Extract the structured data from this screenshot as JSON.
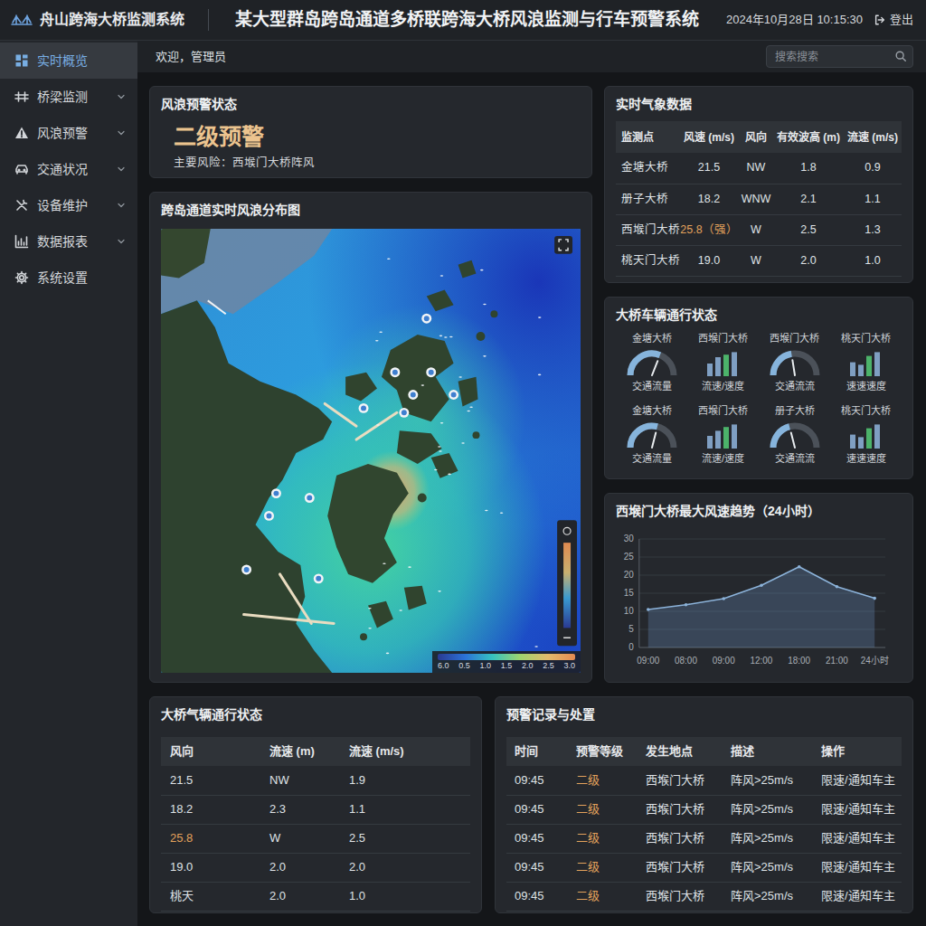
{
  "header": {
    "logo": "舟山跨海大桥监测系统",
    "title": "某大型群岛跨岛通道多桥联跨海大桥风浪监测与行车预警系统",
    "datetime": "2024年10月28日 10:15:30",
    "logout": "登出"
  },
  "sidebar": {
    "items": [
      {
        "label": "实时概览",
        "selected": true,
        "expandable": false
      },
      {
        "label": "桥梁监测",
        "selected": false,
        "expandable": true
      },
      {
        "label": "风浪预警",
        "selected": false,
        "expandable": true
      },
      {
        "label": "交通状况",
        "selected": false,
        "expandable": true
      },
      {
        "label": "设备维护",
        "selected": false,
        "expandable": true
      },
      {
        "label": "数据报表",
        "selected": false,
        "expandable": true
      },
      {
        "label": "系统设置",
        "selected": false,
        "expandable": false
      }
    ]
  },
  "topbar": {
    "welcome": "欢迎，管理员",
    "search": {
      "placeholder": "搜索搜索"
    }
  },
  "alert_status": {
    "title": "风浪预警状态",
    "level": "二级预警",
    "risk": "主要风险：西堠门大桥阵风"
  },
  "map": {
    "title": "跨岛通道实时风浪分布图",
    "legend_ticks": [
      "6.0",
      "0.5",
      "1.0",
      "1.5",
      "2.0",
      "2.5",
      "3.0"
    ]
  },
  "weather": {
    "title": "实时气象数据",
    "columns": [
      "监测点",
      "风速 (m/s)",
      "风向",
      "有效波高 (m)",
      "流速 (m/s)"
    ],
    "rows": [
      {
        "cells": [
          "金塘大桥",
          "21.5",
          "NW",
          "1.8",
          "0.9"
        ],
        "warn": [
          false,
          false,
          false,
          false,
          false
        ]
      },
      {
        "cells": [
          "册子大桥",
          "18.2",
          "WNW",
          "2.1",
          "1.1"
        ],
        "warn": [
          false,
          false,
          false,
          false,
          false
        ]
      },
      {
        "cells": [
          "西堠门大桥",
          "25.8（强）",
          "W",
          "2.5",
          "1.3"
        ],
        "warn": [
          false,
          true,
          false,
          false,
          false
        ]
      },
      {
        "cells": [
          "桃天门大桥",
          "19.0",
          "W",
          "2.0",
          "1.0"
        ],
        "warn": [
          false,
          false,
          false,
          false,
          false
        ]
      }
    ]
  },
  "vehicles": {
    "title": "大桥车辆通行状态",
    "items": [
      {
        "name": "金塘大桥",
        "label": "交通流量",
        "kind": "gauge",
        "level": 0.62
      },
      {
        "name": "西堠门大桥",
        "label": "流速/速度",
        "kind": "bars",
        "bars": [
          {
            "level": 0.5,
            "highlight": false
          },
          {
            "level": 0.75,
            "highlight": false
          },
          {
            "level": 0.85,
            "highlight": true
          },
          {
            "level": 0.95,
            "highlight": false
          }
        ]
      },
      {
        "name": "西堠门大桥",
        "label": "交通流流",
        "kind": "gauge",
        "level": 0.45
      },
      {
        "name": "桃天门大桥",
        "label": "速速速度",
        "kind": "bars",
        "bars": [
          {
            "level": 0.55,
            "highlight": false
          },
          {
            "level": 0.45,
            "highlight": false
          },
          {
            "level": 0.8,
            "highlight": true
          },
          {
            "level": 0.95,
            "highlight": false
          }
        ]
      },
      {
        "name": "金塘大桥",
        "label": "交通流量",
        "kind": "gauge",
        "level": 0.58
      },
      {
        "name": "西堠门大桥",
        "label": "流速/速度",
        "kind": "bars",
        "bars": [
          {
            "level": 0.5,
            "highlight": false
          },
          {
            "level": 0.7,
            "highlight": false
          },
          {
            "level": 0.85,
            "highlight": true
          },
          {
            "level": 0.95,
            "highlight": false
          }
        ]
      },
      {
        "name": "册子大桥",
        "label": "交通流流",
        "kind": "gauge",
        "level": 0.42
      },
      {
        "name": "桃天门大桥",
        "label": "速速速度",
        "kind": "bars",
        "bars": [
          {
            "level": 0.55,
            "highlight": false
          },
          {
            "level": 0.45,
            "highlight": false
          },
          {
            "level": 0.8,
            "highlight": true
          },
          {
            "level": 0.95,
            "highlight": false
          }
        ]
      }
    ]
  },
  "trend": {
    "title": "西堠门大桥最大风速趋势（24小时）",
    "y_ticks": [
      "30",
      "25",
      "20",
      "15",
      "10",
      "5",
      "0"
    ],
    "x_ticks": [
      "09:00",
      "08:00",
      "09:00",
      "12:00",
      "18:00",
      "21:00",
      "24小时"
    ],
    "values": [
      10.5,
      11.8,
      13.5,
      17.2,
      22.3,
      16.8,
      13.6
    ]
  },
  "traffic": {
    "title": "大桥气辆通行状态",
    "columns": [
      "风向",
      "流速 (m)",
      "流速 (m/s)"
    ],
    "rows": [
      {
        "cells": [
          "21.5",
          "NW",
          "1.9"
        ],
        "warn": [
          false,
          false,
          false
        ]
      },
      {
        "cells": [
          "18.2",
          "2.3",
          "1.1"
        ],
        "warn": [
          false,
          false,
          false
        ]
      },
      {
        "cells": [
          "25.8",
          "W",
          "2.5"
        ],
        "warn": [
          true,
          false,
          false
        ]
      },
      {
        "cells": [
          "19.0",
          "2.0",
          "2.0"
        ],
        "warn": [
          false,
          false,
          false
        ]
      },
      {
        "cells": [
          "桃天",
          "2.0",
          "1.0"
        ],
        "warn": [
          false,
          false,
          false
        ]
      }
    ]
  },
  "records": {
    "title": "预警记录与处置",
    "columns": [
      "时间",
      "预警等级",
      "发生地点",
      "描述",
      "操作"
    ],
    "rows": [
      {
        "cells": [
          "09:45",
          "二级",
          "西堠门大桥",
          "阵风>25m/s",
          "限速/通知车主"
        ],
        "warn": [
          false,
          true,
          false,
          false,
          false
        ]
      },
      {
        "cells": [
          "09:45",
          "二级",
          "西堠门大桥",
          "阵风>25m/s",
          "限速/通知车主"
        ],
        "warn": [
          false,
          true,
          false,
          false,
          false
        ]
      },
      {
        "cells": [
          "09:45",
          "二级",
          "西堠门大桥",
          "阵风>25m/s",
          "限速/通知车主"
        ],
        "warn": [
          false,
          true,
          false,
          false,
          false
        ]
      },
      {
        "cells": [
          "09:45",
          "二级",
          "西堠门大桥",
          "阵风>25m/s",
          "限速/通知车主"
        ],
        "warn": [
          false,
          true,
          false,
          false,
          false
        ]
      },
      {
        "cells": [
          "09:45",
          "二级",
          "西堠门大桥",
          "阵风>25m/s",
          "限速/通知车主"
        ],
        "warn": [
          false,
          true,
          false,
          false,
          false
        ]
      }
    ]
  }
}
